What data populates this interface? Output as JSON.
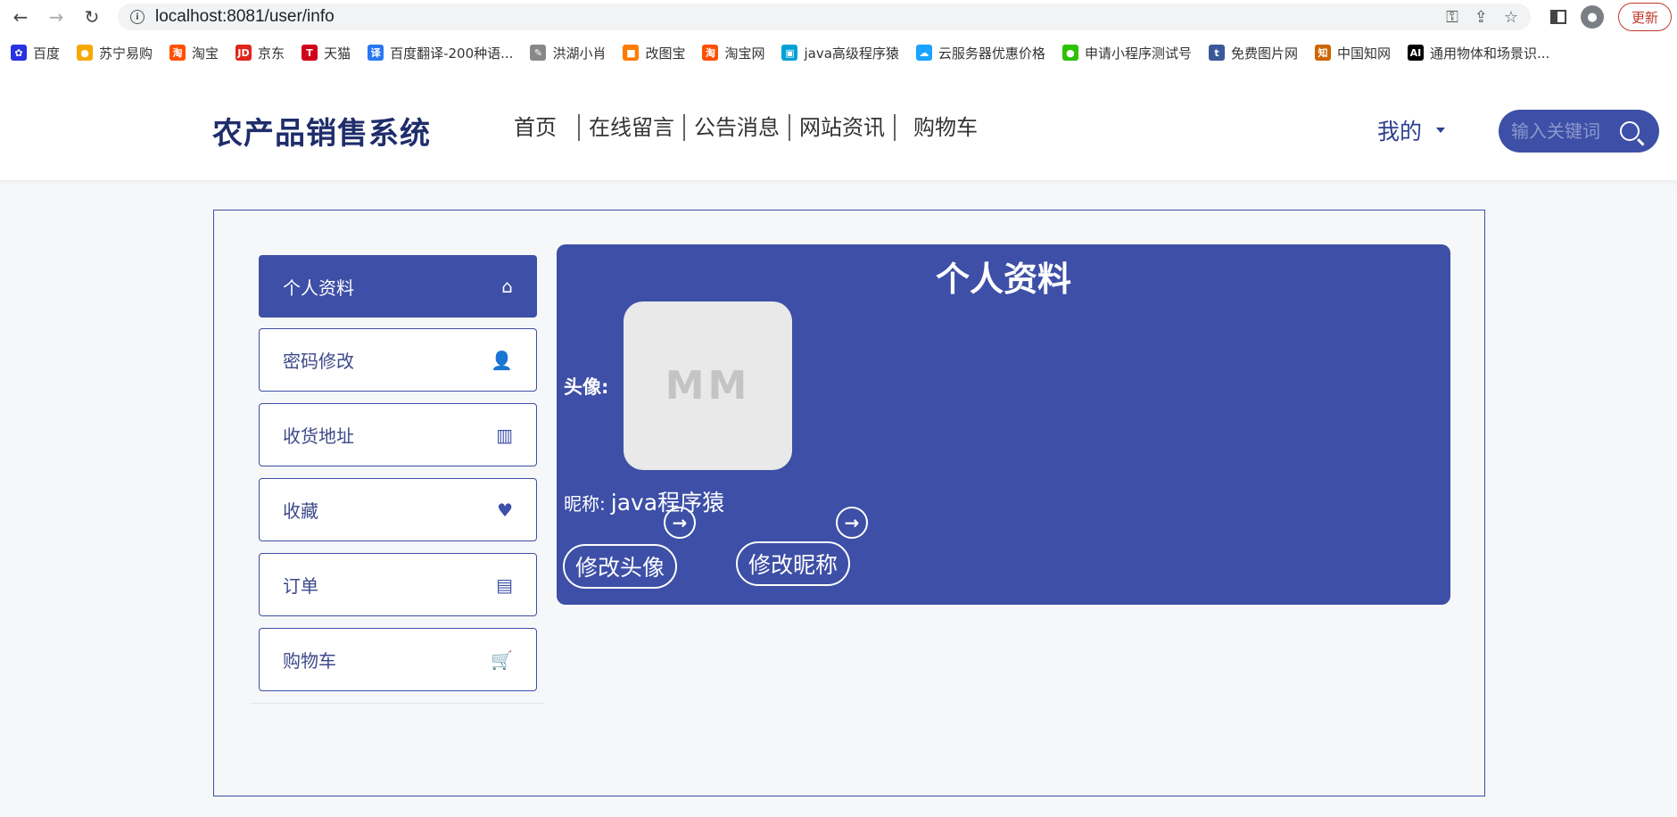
{
  "browser": {
    "url": "localhost:8081/user/info",
    "update_label": "更新",
    "bookmarks": [
      {
        "label": "百度",
        "color": "#2932e1",
        "glyph": "✿"
      },
      {
        "label": "苏宁易购",
        "color": "#f6a800",
        "glyph": "●"
      },
      {
        "label": "淘宝",
        "color": "#ff5000",
        "glyph": "淘"
      },
      {
        "label": "京东",
        "color": "#e1251b",
        "glyph": "JD"
      },
      {
        "label": "天猫",
        "color": "#d1001b",
        "glyph": "T"
      },
      {
        "label": "百度翻译-200种语...",
        "color": "#2a77f2",
        "glyph": "译"
      },
      {
        "label": "洪湖小肖",
        "color": "#888888",
        "glyph": "✎"
      },
      {
        "label": "改图宝",
        "color": "#ff7b00",
        "glyph": "■"
      },
      {
        "label": "淘宝网",
        "color": "#ff5000",
        "glyph": "淘"
      },
      {
        "label": "java高级程序猿",
        "color": "#00a1d6",
        "glyph": "▣"
      },
      {
        "label": "云服务器优惠价格",
        "color": "#1aa3ff",
        "glyph": "☁"
      },
      {
        "label": "申请小程序测试号",
        "color": "#2dc100",
        "glyph": "●"
      },
      {
        "label": "免费图片网",
        "color": "#3b5998",
        "glyph": "t"
      },
      {
        "label": "中国知网",
        "color": "#cc6600",
        "glyph": "知"
      },
      {
        "label": "通用物体和场景识...",
        "color": "#000000",
        "glyph": "AI"
      }
    ]
  },
  "header": {
    "site_title": "农产品销售系统",
    "nav": [
      "首页",
      "在线留言",
      "公告消息",
      "网站资讯",
      "购物车"
    ],
    "mine_label": "我的",
    "search_placeholder": "输入关键词"
  },
  "sidebar": {
    "items": [
      {
        "label": "个人资料",
        "icon": "home-icon",
        "glyph": "⌂",
        "active": true
      },
      {
        "label": "密码修改",
        "icon": "user-icon",
        "glyph": "👤",
        "active": false
      },
      {
        "label": "收货地址",
        "icon": "map-icon",
        "glyph": "▥",
        "active": false
      },
      {
        "label": "收藏",
        "icon": "heart-icon",
        "glyph": "♥",
        "active": false
      },
      {
        "label": "订单",
        "icon": "file-icon",
        "glyph": "▤",
        "active": false
      },
      {
        "label": "购物车",
        "icon": "cart-icon",
        "glyph": "🛒",
        "active": false
      }
    ]
  },
  "profile": {
    "title": "个人资料",
    "avatar_label": "头像:",
    "avatar_placeholder": "MM",
    "nickname_label": "昵称:",
    "nickname_value": "java程序猿",
    "change_avatar_label": "修改头像",
    "change_nickname_label": "修改昵称"
  },
  "colors": {
    "accent": "#3d4fa6",
    "title": "#1f2d6b",
    "update": "#c0392b"
  }
}
